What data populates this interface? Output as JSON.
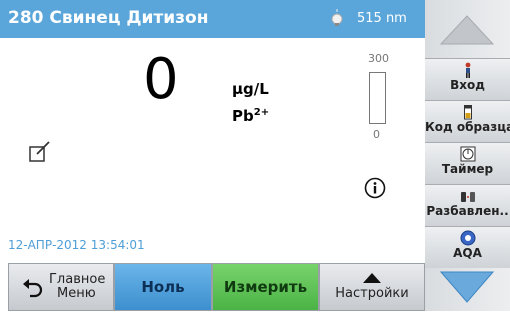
{
  "header": {
    "title": "280 Свинец Дитизон",
    "wavelength": "515 nm"
  },
  "reading": {
    "value": "0",
    "unit": "µg/L",
    "chem_base": "Pb",
    "chem_charge": "2+"
  },
  "scale": {
    "max": "300",
    "min": "0",
    "level": 0
  },
  "datetime": "12-АПР-2012  13:54:01",
  "bottom": {
    "home_line1": "Главное",
    "home_line2": "Меню",
    "zero": "Ноль",
    "measure": "Измерить",
    "settings": "Настройки"
  },
  "sidebar": {
    "items": [
      {
        "label": "Вход",
        "icon": "person-icon"
      },
      {
        "label": "Код образца",
        "icon": "sample-vial-icon"
      },
      {
        "label": "Таймер",
        "icon": "timer-icon"
      },
      {
        "label": "Разбавлен..",
        "icon": "dilution-icon"
      },
      {
        "label": "AQA",
        "icon": "aqa-icon"
      }
    ]
  },
  "colors": {
    "header": "#5aa6da",
    "zero": "#4a9ede",
    "measure": "#5cc255",
    "arrow": "#6aa9dc"
  }
}
